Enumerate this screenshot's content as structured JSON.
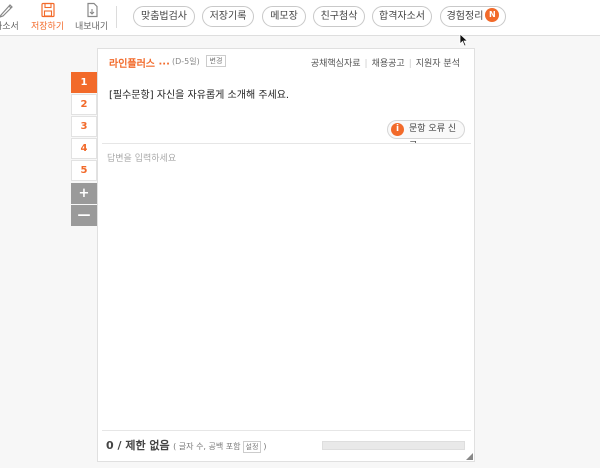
{
  "toolbar": {
    "tools": {
      "self_intro": "자소서",
      "save": "저장하기",
      "export": "내보내기"
    },
    "pills": {
      "spellcheck": "맞춤법검사",
      "save_history": "저장기록",
      "memo": "메모장",
      "friend_review": "친구첨삭",
      "passed_essays": "합격자소서",
      "experience": "경험정리",
      "experience_badge": "N"
    }
  },
  "tabs": {
    "items": [
      "1",
      "2",
      "3",
      "4",
      "5"
    ],
    "active_index": 0,
    "add": "+",
    "remove": "—"
  },
  "panel": {
    "company": "라인플러스 ···",
    "dday": "(D-5일)",
    "change": "변경",
    "links": [
      "공채핵심자료",
      "채용공고",
      "지원자 분석"
    ],
    "question": "[필수문항] 자신을 자유롭게 소개해 주세요.",
    "report": {
      "icon_text": "i",
      "label": "문항 오류 신고"
    },
    "answer_placeholder": "답변을 입력하세요",
    "answer_value": "",
    "count": {
      "main": "0 / 제한 없음",
      "sub_open": "( 글자 수, 공백 포함",
      "setting": "설정",
      "sub_close": ")"
    },
    "progress": 0
  },
  "colors": {
    "accent": "#f26a2a",
    "tab_gray": "#9a9a9a"
  },
  "icons": [
    "pencil-icon",
    "save-icon",
    "export-icon",
    "info-icon",
    "cursor-icon",
    "resize-grip-icon"
  ]
}
